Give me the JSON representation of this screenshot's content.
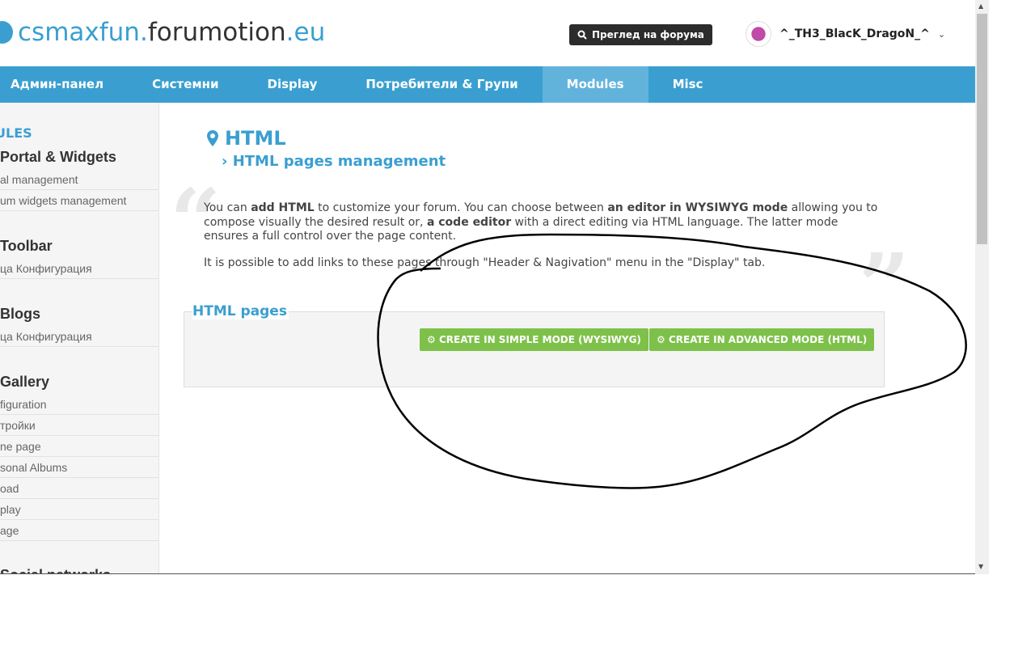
{
  "header": {
    "logo_main": "csmaxfun.",
    "logo_mid": "forumotion",
    "logo_tld": ".eu",
    "preview_button": "Преглед на форума",
    "username": "^_TH3_BlacK_DragoN_^"
  },
  "nav": {
    "items": [
      {
        "label": "Админ-панел"
      },
      {
        "label": "Системни"
      },
      {
        "label": "Display"
      },
      {
        "label": "Потребители & Групи"
      },
      {
        "label": "Modules",
        "active": true
      },
      {
        "label": "Misc"
      }
    ]
  },
  "sidebar": {
    "title": "ULES",
    "sections": [
      {
        "heading": "Portal & Widgets",
        "links": [
          "al management",
          "um widgets management"
        ]
      },
      {
        "heading": "Toolbar",
        "links": [
          "ца Конфигурация"
        ]
      },
      {
        "heading": "Blogs",
        "links": [
          "ца Конфигурация"
        ]
      },
      {
        "heading": "Gallery",
        "links": [
          "figuration",
          "тройки",
          "ne page",
          "sonal Albums",
          "oad",
          "play",
          "age"
        ]
      },
      {
        "heading": "Social networks",
        "links": []
      }
    ]
  },
  "main": {
    "title": "HTML",
    "subtitle": "HTML pages management",
    "desc1_parts": [
      "You can ",
      "add HTML",
      " to customize your forum. You can choose between ",
      "an editor in WYSIWYG mode",
      " allowing you to compose visually the desired result or, ",
      "a code editor",
      " with a direct editing via HTML language. The latter mode ensures a full control over the page content."
    ],
    "desc2": "It is possible to add links to these pages through \"Header & Nagivation\" menu in the \"Display\" tab.",
    "box_title": "HTML pages",
    "btn_simple": "CREATE IN SIMPLE MODE (WYSIWYG)",
    "btn_advanced": "CREATE IN ADVANCED MODE (HTML)"
  },
  "colors": {
    "accent": "#3a9fd0",
    "nav_active": "#62b3dc",
    "button_green": "#7dc14a"
  }
}
